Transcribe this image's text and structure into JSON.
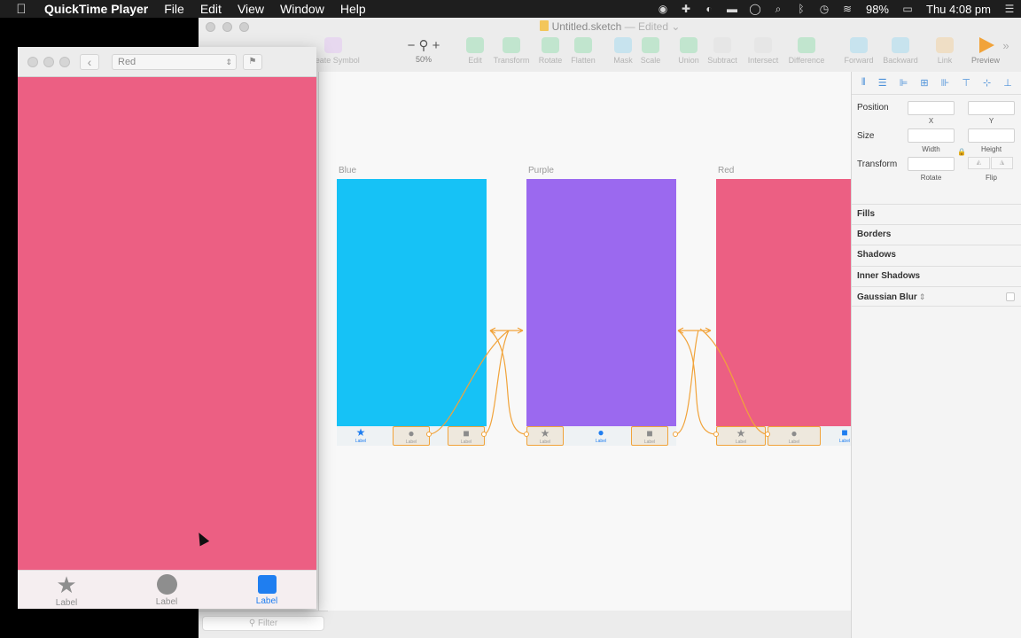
{
  "menubar": {
    "app_name": "QuickTime Player",
    "items": [
      "File",
      "Edit",
      "View",
      "Window",
      "Help"
    ],
    "battery": "98%",
    "clock": "Thu 4:08 pm"
  },
  "sketch": {
    "doc_title": "Untitled.sketch",
    "doc_status": "— Edited ⌄",
    "toolbar": {
      "create_symbol": "Create Symbol",
      "zoom_level": "50%",
      "edit": "Edit",
      "transform": "Transform",
      "rotate": "Rotate",
      "flatten": "Flatten",
      "mask": "Mask",
      "scale": "Scale",
      "union": "Union",
      "subtract": "Subtract",
      "intersect": "Intersect",
      "difference": "Difference",
      "forward": "Forward",
      "backward": "Backward",
      "link": "Link",
      "preview": "Preview"
    },
    "artboards": [
      {
        "name": "Blue",
        "color": "#16c2f6"
      },
      {
        "name": "Purple",
        "color": "#9b69ef"
      },
      {
        "name": "Red",
        "color": "#ec5f83"
      }
    ],
    "mini_tab_label": "Label",
    "filter_placeholder": "Filter",
    "inspector": {
      "position": "Position",
      "x": "X",
      "y": "Y",
      "size": "Size",
      "width": "Width",
      "height": "Height",
      "transform": "Transform",
      "rotate": "Rotate",
      "flip": "Flip",
      "sections": [
        "Fills",
        "Borders",
        "Shadows",
        "Inner Shadows",
        "Gaussian Blur"
      ]
    },
    "accent_color": "#f1a33a"
  },
  "preview": {
    "selected_artboard": "Red",
    "screen_color": "#ec5f83",
    "tabs": [
      {
        "label": "Label",
        "icon": "star-icon"
      },
      {
        "label": "Label",
        "icon": "circle-icon"
      },
      {
        "label": "Label",
        "icon": "square-icon",
        "active": true
      }
    ]
  }
}
